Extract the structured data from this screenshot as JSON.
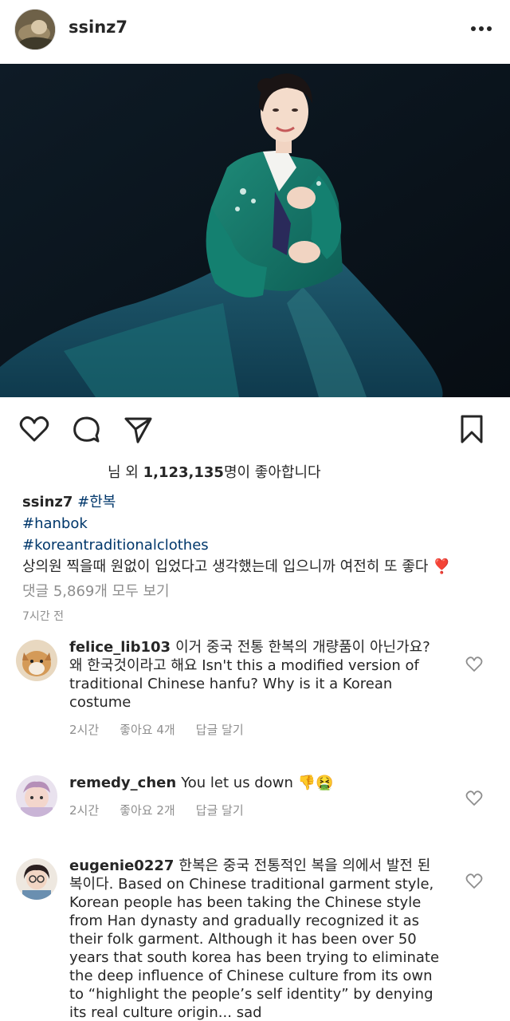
{
  "post": {
    "username": "ssinz7",
    "more_icon": "more-horizontal-icon"
  },
  "actions": {
    "like_icon": "heart-icon",
    "comment_icon": "comment-icon",
    "share_icon": "send-icon",
    "save_icon": "bookmark-icon"
  },
  "likes": {
    "prefix": "님 외 ",
    "count": "1,123,135",
    "suffix": "명이 좋아합니다"
  },
  "caption": {
    "username": "ssinz7",
    "tag1": "#한복",
    "tag2": "#hanbok",
    "tag3": "#koreantraditionalclothes",
    "text": "상의원 찍을때 원없이 입었다고 생각했는데 입으니까 여전히 또 좋다",
    "emoji": "❣️"
  },
  "view_comments": "댓글 5,869개 모두 보기",
  "time_ago": "7시간 전",
  "comments": [
    {
      "username": "felice_lib103",
      "text": "이거 중국 전통 한복의 개량품이 아닌가요? 왜 한국것이라고 해요  Isn't this a modified version of traditional Chinese hanfu? Why is it a Korean costume",
      "time": "2시간",
      "likes": "좋아요 4개",
      "reply": "답글 달기"
    },
    {
      "username": "remedy_chen",
      "text": "You let us down",
      "emoji": "👎🤮",
      "time": "2시간",
      "likes": "좋아요 2개",
      "reply": "답글 달기"
    },
    {
      "username": "eugenie0227",
      "text": "한복은 중국 전통적인 복을 의에서 발전 된 복이다. Based on Chinese traditional garment style, Korean people has been taking the Chinese style from Han dynasty and gradually recognized it as their folk garment. Although it has been over 50 years that south korea has been trying to eliminate the deep influence of Chinese culture from its own to “highlight the people’s self identity” by denying its real culture origin... sad"
    }
  ]
}
